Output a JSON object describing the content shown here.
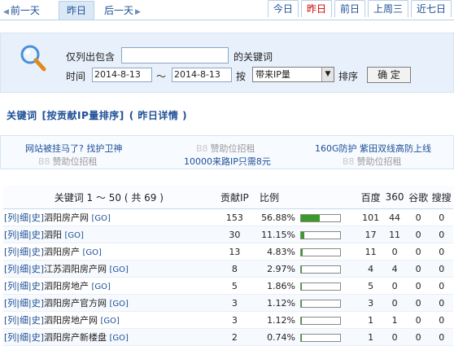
{
  "nav": {
    "prev": "前一天",
    "current": "昨日",
    "next": "后一天",
    "tabs": [
      {
        "label": "今日",
        "active": false
      },
      {
        "label": "昨日",
        "active": true
      },
      {
        "label": "前日",
        "active": false
      },
      {
        "label": "上周三",
        "active": false
      },
      {
        "label": "近七日",
        "active": false
      }
    ]
  },
  "filter": {
    "only_list": "仅列出包含",
    "keyword_value": "",
    "keyword_suffix": "的关键词",
    "time_label": "时间",
    "date_from": "2014-8-13",
    "tilde": "～",
    "date_to": "2014-8-13",
    "by_label": "按",
    "sort_option": "带来IP量",
    "sort_label": "排序",
    "confirm": "确 定"
  },
  "crumb": {
    "part1": "关键词",
    "part2": "[按贡献IP量排序]",
    "part3": "( 昨日详情 )"
  },
  "ads": {
    "a1": "网站被挂马了? 找护卫神",
    "a2_b8": "B8",
    "a2": "赞助位招租",
    "a3": "160G防护 紫田双线高防上线",
    "a4_b8": "B8",
    "a4": "赞助位招租",
    "a5": "10000来路IP只需8元",
    "a6_b8": "B8",
    "a6": "赞助位招租"
  },
  "table": {
    "headers": {
      "keyword": "关键词 1 ～ 50 ( 共 69 )",
      "ip": "贡献IP",
      "ratio": "比例",
      "baidu": "百度",
      "s360": "360",
      "google": "谷歌",
      "sogou": "搜搜"
    },
    "link_text": "[列|细|史]",
    "go": "[GO]",
    "rows": [
      {
        "kw": "泗阳房产网",
        "ip": "153",
        "pct": "56.88%",
        "ratio": 0.5688,
        "baidu": "101",
        "s360": "44",
        "google": "0",
        "sogou": "0"
      },
      {
        "kw": "泗阳",
        "ip": "30",
        "pct": "11.15%",
        "ratio": 0.1115,
        "baidu": "17",
        "s360": "11",
        "google": "0",
        "sogou": "0"
      },
      {
        "kw": "泗阳房产",
        "ip": "13",
        "pct": "4.83%",
        "ratio": 0.0483,
        "baidu": "11",
        "s360": "0",
        "google": "0",
        "sogou": "0"
      },
      {
        "kw": "江苏泗阳房产网",
        "ip": "8",
        "pct": "2.97%",
        "ratio": 0.0297,
        "baidu": "4",
        "s360": "4",
        "google": "0",
        "sogou": "0"
      },
      {
        "kw": "泗阳房地产",
        "ip": "5",
        "pct": "1.86%",
        "ratio": 0.0186,
        "baidu": "5",
        "s360": "0",
        "google": "0",
        "sogou": "0"
      },
      {
        "kw": "泗阳房产官方网",
        "ip": "3",
        "pct": "1.12%",
        "ratio": 0.0112,
        "baidu": "3",
        "s360": "0",
        "google": "0",
        "sogou": "0"
      },
      {
        "kw": "泗阳房地产网",
        "ip": "3",
        "pct": "1.12%",
        "ratio": 0.0112,
        "baidu": "1",
        "s360": "1",
        "google": "0",
        "sogou": "0"
      },
      {
        "kw": "泗阳房产新楼盘",
        "ip": "2",
        "pct": "0.74%",
        "ratio": 0.0074,
        "baidu": "1",
        "s360": "0",
        "google": "0",
        "sogou": "0"
      }
    ]
  },
  "colors": {
    "accent": "#1d4f96",
    "bar": "#3c9a2a",
    "active_tab": "#cc0000"
  }
}
